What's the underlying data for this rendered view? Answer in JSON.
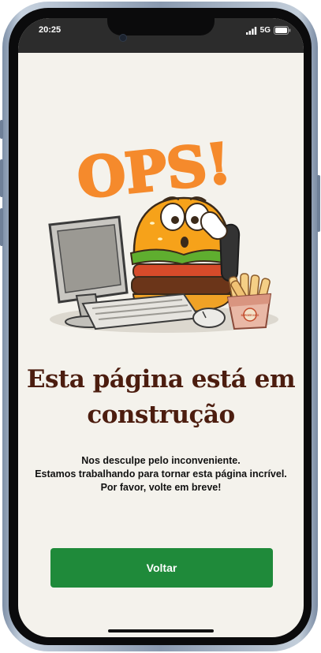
{
  "status_bar": {
    "time": "20:25",
    "network": "5G"
  },
  "illustration": {
    "headline": "OPS!",
    "box_label": "BURGER KING"
  },
  "content": {
    "title_line1": "Esta página está em",
    "title_line2": "construção",
    "message_lines": [
      "Nos desculpe pelo inconveniente.",
      "Estamos trabalhando para tornar esta página incrível.",
      "Por favor, volte em breve!"
    ]
  },
  "actions": {
    "back_label": "Voltar"
  },
  "colors": {
    "background": "#f4f2ec",
    "title": "#4c1d0f",
    "button": "#1f8a3a",
    "ops_orange": "#f58a2c"
  }
}
